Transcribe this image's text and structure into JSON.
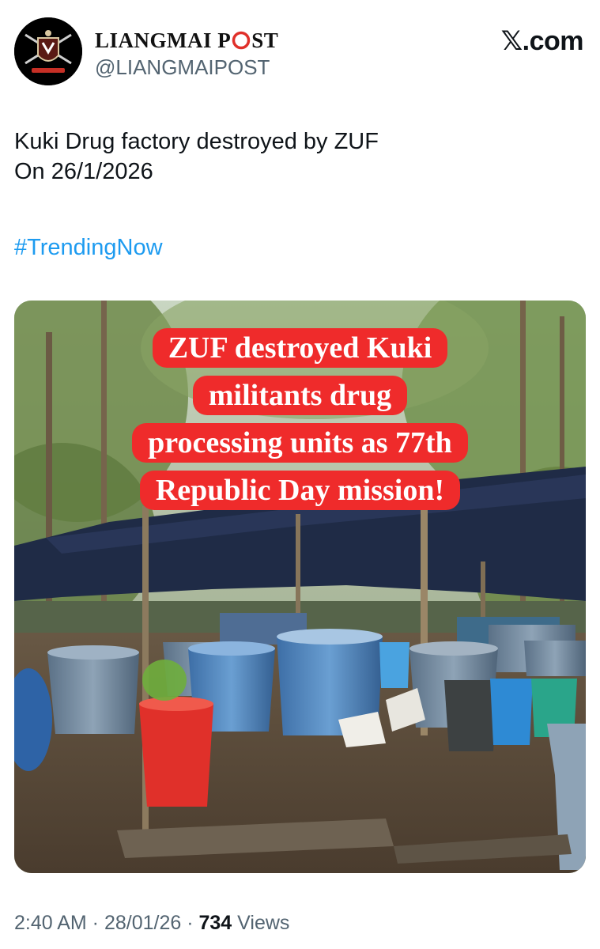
{
  "account": {
    "display_name_start": "LIANGMAI P",
    "display_name_end": "ST",
    "handle": "@LIANGMAIPOST",
    "avatar_icon": "liangmai-post-logo",
    "avatar_logo_text": "LIANGMAI POST"
  },
  "source": {
    "label": "𝕏.com"
  },
  "tweet": {
    "text_line1": "Kuki Drug factory destroyed by ZUF",
    "text_line2": "On 26/1/2026",
    "hashtag": "#TrendingNow"
  },
  "media": {
    "overlay_line1": "ZUF destroyed Kuki",
    "overlay_line2": "militants drug",
    "overlay_line3": "processing units as 77th",
    "overlay_line4": "Republic Day mission!",
    "overlay_bg_color": "#ef2b2b"
  },
  "meta": {
    "time": "2:40 AM",
    "separator": " · ",
    "date": "28/01/26",
    "views_count": "734",
    "views_label": " Views"
  },
  "colors": {
    "link": "#1d9bf0",
    "secondary_text": "#536471",
    "primary_text": "#0f1419",
    "logo_accent": "#e0302a"
  }
}
